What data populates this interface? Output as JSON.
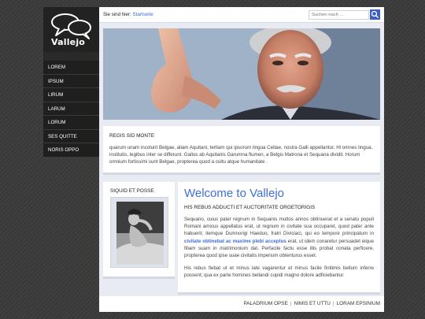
{
  "logo": {
    "text": "Vallejo"
  },
  "nav": {
    "items": [
      {
        "label": "LOREM"
      },
      {
        "label": "IPSUM"
      },
      {
        "label": "LIRUM"
      },
      {
        "label": "LARUM"
      },
      {
        "label": "LORUM"
      },
      {
        "label": "SES QUITTE"
      },
      {
        "label": "NORIS OPPO"
      }
    ]
  },
  "header": {
    "breadcrumb_prefix": "Sie sind hier:",
    "breadcrumb_link": "Startseite",
    "search_placeholder": "Suchen nach ...",
    "search_icon": "search-icon"
  },
  "hero": {
    "image": "man pointing at viewer"
  },
  "intro": {
    "title": "REGIS SID MONTE",
    "text": "quarum unam incolunt Belgae, aliam Aquitani, tertiam qui ipsorum lingua Celtae, nostra Galli appellantur. Hi omnes lingua, institutis, legibus inter se differunt. Gallos ab Aquitanis Garumna flumen, a Belgis Matrona et Sequana dividit. Horum omnium fortissimi sunt Belgae, propterea quod a cultu atque humanitate ."
  },
  "side_card": {
    "title": "SIQUID ET POSSE"
  },
  "article": {
    "heading": "Welcome to Vallejo",
    "subheading": "HIS REBUS ADDUCTI ET AUCTORITATE ORGETORIGIS",
    "p1_before": "Sequano, cuius pater regnum in Sequanis multos annos obtinuerat et a senatu populi Romani amicus appellatus erat, ut regnum in civitate sua occuparet, quod pater ante habuerit; itemque Dumnorigi Haeduo, fratri Diviciaci, qui eo tempore principatum in",
    "p1_link": "civitate obtinebat ac maxime plebi acceptus",
    "p1_after": "erat, ut idem conaretur persuadet eique filiam suam in matrimonium dat. Perfacile factu esse illis probat conata perficere, propterea quod ipse suae civitatis imperium obtenturus esset.",
    "p2": "His rebus fiebat ut et minus late vagarentur et minus facile finitimis bellum inferre possent; qua ex parte homines bellandi cupidi magno dolore adficiebantur."
  },
  "footer": {
    "links": [
      "PALADRIUM OPSE",
      "NIMIS ET UTTU",
      "LORAM EPSINIUM"
    ],
    "separator": "|"
  }
}
